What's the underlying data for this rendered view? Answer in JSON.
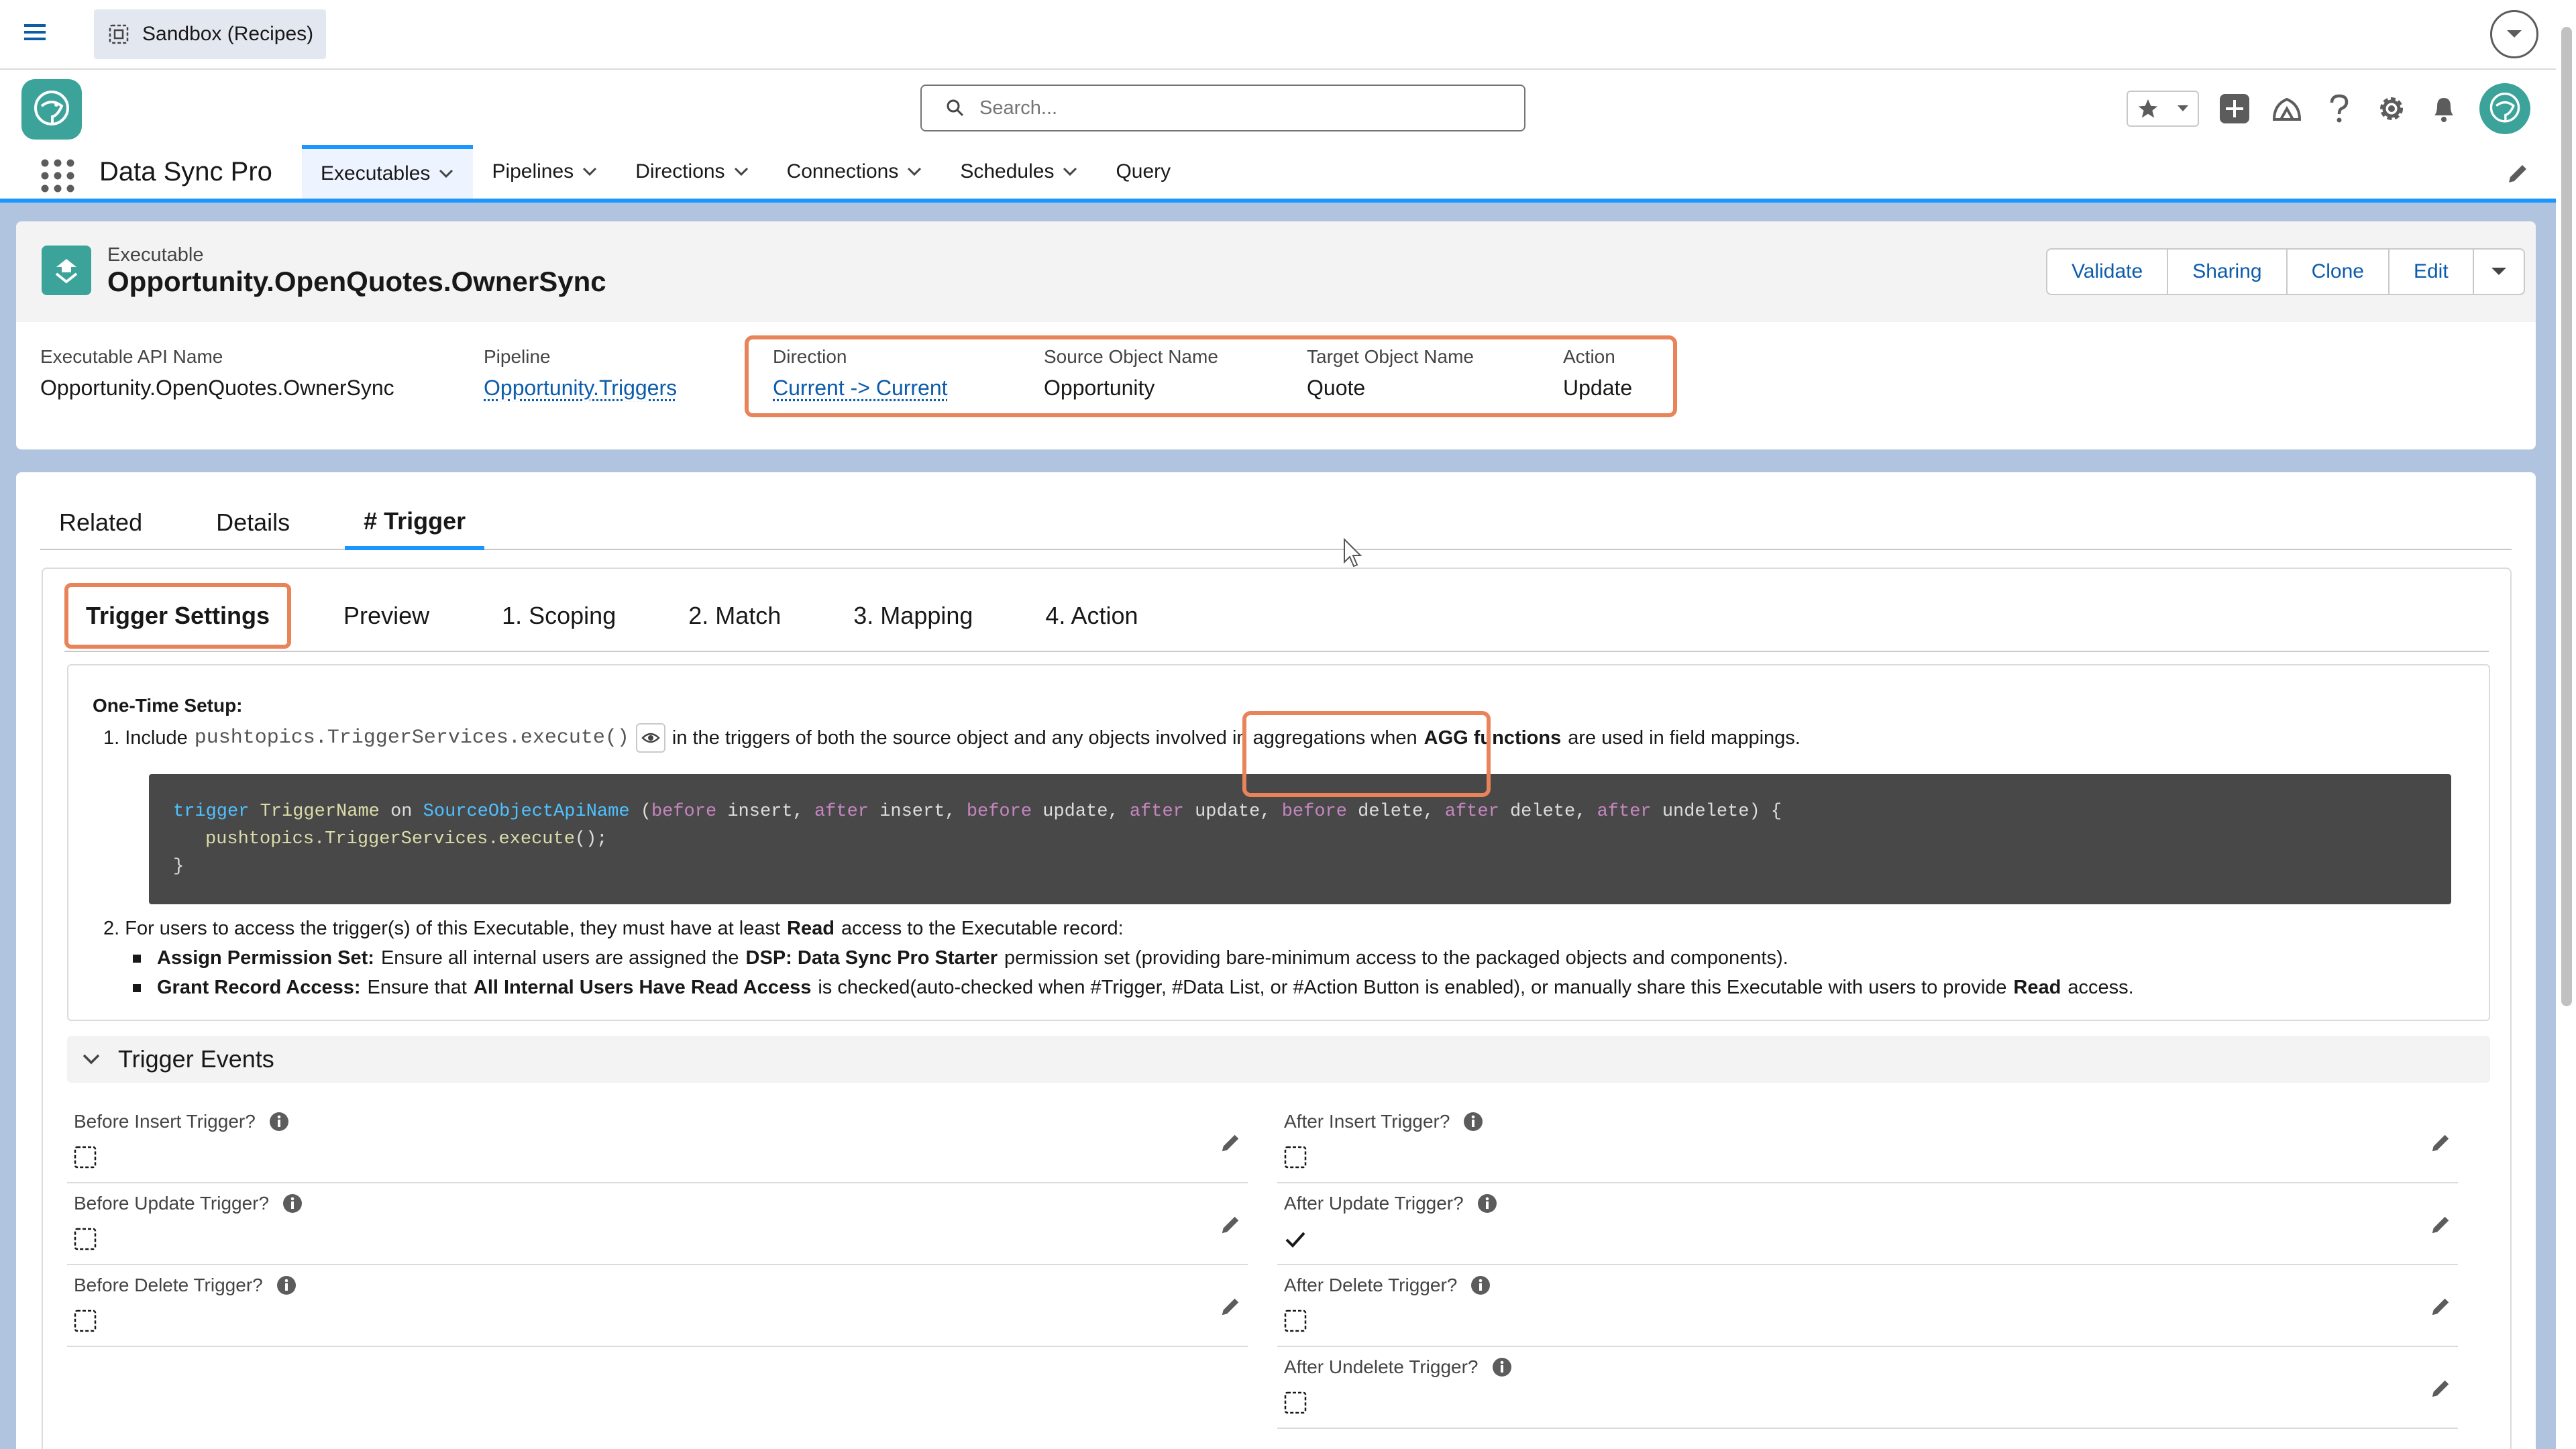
{
  "sandbox": {
    "label": "Sandbox (Recipes)"
  },
  "search": {
    "placeholder": "Search..."
  },
  "app": {
    "name": "Data Sync Pro"
  },
  "nav": {
    "tabs": [
      {
        "label": "Executables",
        "has_menu": true
      },
      {
        "label": "Pipelines",
        "has_menu": true
      },
      {
        "label": "Directions",
        "has_menu": true
      },
      {
        "label": "Connections",
        "has_menu": true
      },
      {
        "label": "Schedules",
        "has_menu": true
      },
      {
        "label": "Query",
        "has_menu": false
      }
    ]
  },
  "record": {
    "type": "Executable",
    "title": "Opportunity.OpenQuotes.OwnerSync",
    "actions": [
      "Validate",
      "Sharing",
      "Clone",
      "Edit"
    ],
    "fields": {
      "api_name": {
        "label": "Executable API Name",
        "value": "Opportunity.OpenQuotes.OwnerSync"
      },
      "pipeline": {
        "label": "Pipeline",
        "value": "Opportunity.Triggers"
      },
      "direction": {
        "label": "Direction",
        "value": "Current -> Current"
      },
      "source": {
        "label": "Source Object Name",
        "value": "Opportunity"
      },
      "target": {
        "label": "Target Object Name",
        "value": "Quote"
      },
      "action": {
        "label": "Action",
        "value": "Update"
      }
    }
  },
  "tabs": [
    "Related",
    "Details",
    "# Trigger"
  ],
  "subtabs": [
    "Trigger Settings",
    "Preview",
    "1. Scoping",
    "2. Match",
    "3. Mapping",
    "4. Action"
  ],
  "setup": {
    "title": "One-Time Setup:",
    "step1": {
      "prefix": "1. Include",
      "code": "pushtopics.TriggerServices.execute()",
      "text_a": "in the triggers of both the source object and any objects involved in aggregations when",
      "bold": "AGG functions",
      "text_b": "are used in field mappings."
    },
    "code_lines": {
      "l1": {
        "t1": "trigger",
        "t2": "TriggerName",
        "t3": "on",
        "t4": "SourceObjectApiName",
        "t5": "(",
        "k1": "before",
        "v1": "insert,",
        "k2": "after",
        "v2": "insert,",
        "k3": "before",
        "v3": "update,",
        "k4": "after",
        "v4": "update,",
        "k5": "before",
        "v5": "delete,",
        "k6": "after",
        "v6": "delete,",
        "k7": "after",
        "v7": "undelete) {"
      },
      "l2": {
        "obj": "pushtopics.TriggerServices.",
        "fn": "execute",
        "end": "();"
      },
      "l3": "}"
    },
    "step2": {
      "a": "2. For users to access the trigger(s) of this Executable, they must have at least",
      "bold": "Read",
      "b": "access to the Executable record:"
    },
    "bullet1": {
      "bold": "Assign Permission Set:",
      "a": "Ensure all internal users are assigned the",
      "bold2": "DSP: Data Sync Pro Starter",
      "b": "permission set (providing bare-minimum access to the packaged objects and components)."
    },
    "bullet2": {
      "bold": "Grant Record Access:",
      "a": "Ensure that",
      "bold2": "All Internal Users Have Read Access",
      "b": "is checked(auto-checked when #Trigger, #Data List, or #Action Button is enabled), or manually share this Executable with users to provide",
      "bold3": "Read",
      "c": "access."
    }
  },
  "events": {
    "title": "Trigger Events",
    "left": [
      {
        "label": "Before Insert Trigger?",
        "checked": false
      },
      {
        "label": "Before Update Trigger?",
        "checked": false
      },
      {
        "label": "Before Delete Trigger?",
        "checked": false
      }
    ],
    "right": [
      {
        "label": "After Insert Trigger?",
        "checked": false
      },
      {
        "label": "After Update Trigger?",
        "checked": true
      },
      {
        "label": "After Delete Trigger?",
        "checked": false
      },
      {
        "label": "After Undelete Trigger?",
        "checked": false
      }
    ]
  },
  "colors": {
    "accent": "#1b96ff",
    "highlight": "#e8835a",
    "brand": "#3ba39a",
    "link": "#0b5cab"
  }
}
